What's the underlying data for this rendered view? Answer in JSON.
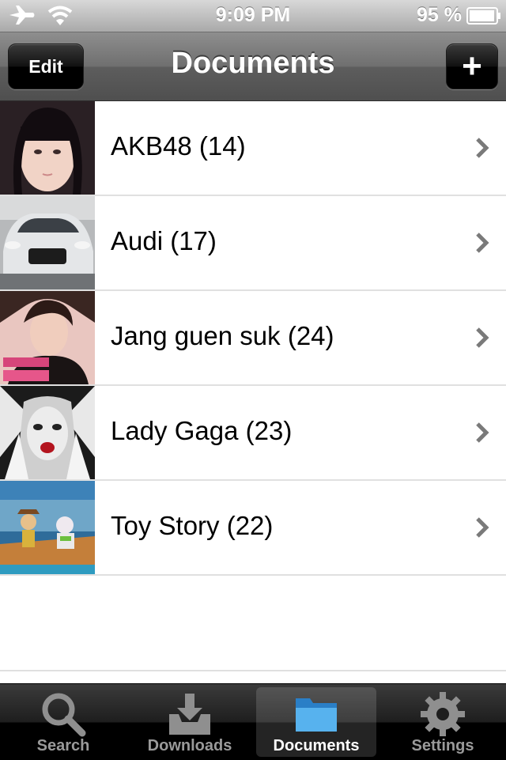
{
  "status_bar": {
    "time": "9:09 PM",
    "battery": "95 %",
    "icons": [
      "airplane-icon",
      "wifi-icon",
      "battery-icon"
    ]
  },
  "nav": {
    "title": "Documents",
    "edit_label": "Edit",
    "add_label": "+"
  },
  "documents": [
    {
      "label": "AKB48 (14)"
    },
    {
      "label": "Audi (17)"
    },
    {
      "label": "Jang guen suk (24)"
    },
    {
      "label": "Lady Gaga (23)"
    },
    {
      "label": "Toy Story (22)"
    }
  ],
  "tabs": [
    {
      "label": "Search",
      "icon": "magnifier-icon",
      "active": false
    },
    {
      "label": "Downloads",
      "icon": "download-tray-icon",
      "active": false
    },
    {
      "label": "Documents",
      "icon": "folder-icon",
      "active": true
    },
    {
      "label": "Settings",
      "icon": "gear-icon",
      "active": false
    }
  ],
  "colors": {
    "tab_active_icon": "#3f9be0",
    "chevron": "#7a7a7a",
    "separator": "#e0e0e0"
  }
}
